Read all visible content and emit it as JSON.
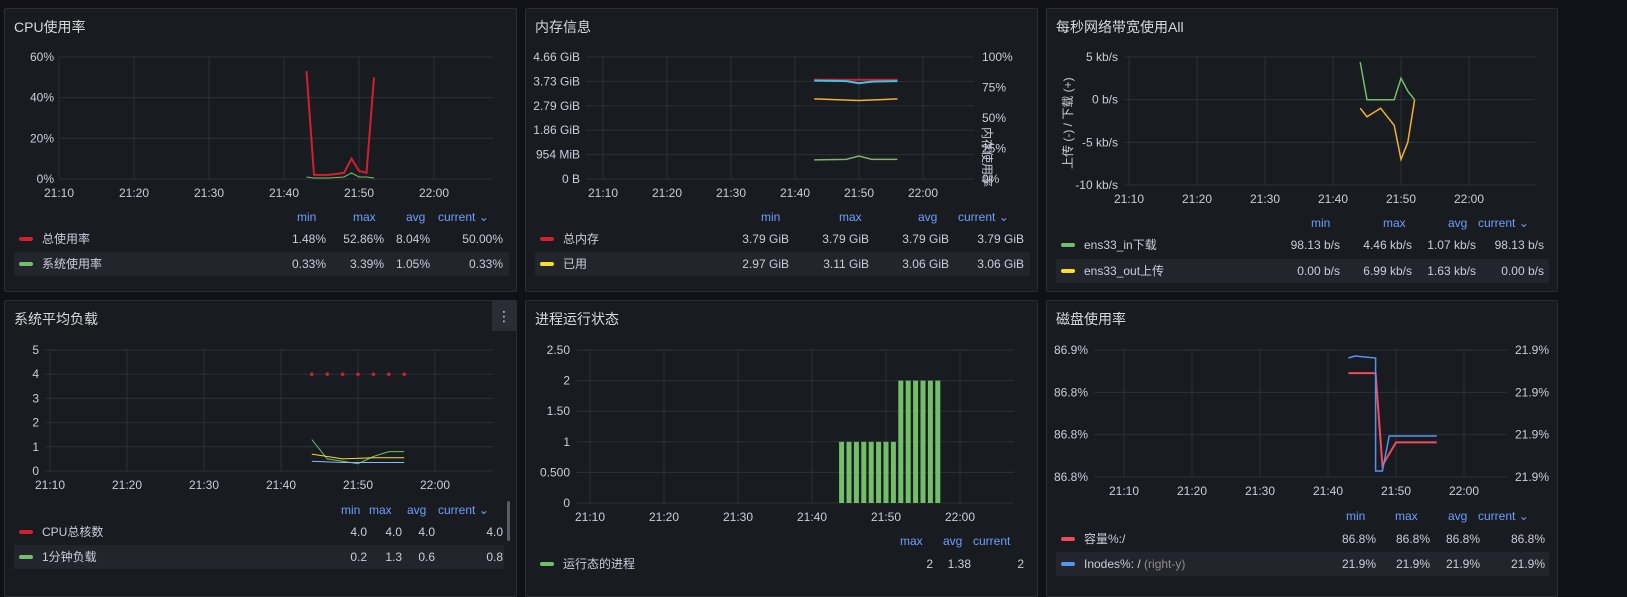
{
  "colors": {
    "red": "#d21f2e",
    "green": "#73bf69",
    "yellow": "#fade2a",
    "blue": "#5794f2",
    "cyan": "#37c8e8",
    "orange": "#f2b132",
    "legend_header": "#6e9fff"
  },
  "panels": {
    "cpu": {
      "title": "CPU使用率",
      "y_ticks": [
        "60%",
        "40%",
        "20%",
        "0%"
      ],
      "x_ticks": [
        "21:10",
        "21:20",
        "21:30",
        "21:40",
        "21:50",
        "22:00"
      ],
      "legend_headers": [
        "min",
        "max",
        "avg",
        "current"
      ],
      "legend": [
        {
          "name": "总使用率",
          "min": "1.48%",
          "max": "52.86%",
          "avg": "8.04%",
          "current": "50.00%",
          "color": "#d21f2e"
        },
        {
          "name": "系统使用率",
          "min": "0.33%",
          "max": "3.39%",
          "avg": "1.05%",
          "current": "0.33%",
          "color": "#73bf69"
        }
      ]
    },
    "mem": {
      "title": "内存信息",
      "y_ticks": [
        "4.66 GiB",
        "3.73 GiB",
        "2.79 GiB",
        "1.86 GiB",
        "954 MiB",
        "0 B"
      ],
      "y2_ticks": [
        "100%",
        "75%",
        "50%",
        "25%",
        "0%"
      ],
      "y2_label": "内存使用率",
      "x_ticks": [
        "21:10",
        "21:20",
        "21:30",
        "21:40",
        "21:50",
        "22:00"
      ],
      "legend_headers": [
        "min",
        "max",
        "avg",
        "current"
      ],
      "legend": [
        {
          "name": "总内存",
          "min": "3.79 GiB",
          "max": "3.79 GiB",
          "avg": "3.79 GiB",
          "current": "3.79 GiB",
          "color": "#d21f2e"
        },
        {
          "name": "已用",
          "min": "2.97 GiB",
          "max": "3.11 GiB",
          "avg": "3.06 GiB",
          "current": "3.06 GiB",
          "color": "#fade2a"
        }
      ]
    },
    "net": {
      "title": "每秒网络带宽使用All",
      "y_ticks": [
        "5 kb/s",
        "0 b/s",
        "-5 kb/s",
        "-10 kb/s"
      ],
      "y_label": "上传 (-) / 下载 (+)",
      "x_ticks": [
        "21:10",
        "21:20",
        "21:30",
        "21:40",
        "21:50",
        "22:00"
      ],
      "legend_headers": [
        "min",
        "max",
        "avg",
        "current"
      ],
      "legend": [
        {
          "name": "ens33_in下载",
          "min": "98.13 b/s",
          "max": "4.46 kb/s",
          "avg": "1.07 kb/s",
          "current": "98.13 b/s",
          "color": "#73bf69"
        },
        {
          "name": "ens33_out上传",
          "min": "0.00 b/s",
          "max": "6.99 kb/s",
          "avg": "1.63 kb/s",
          "current": "0.00 b/s",
          "color": "#fade2a"
        }
      ]
    },
    "load": {
      "title": "系统平均负载",
      "menu": "⋮",
      "y_ticks": [
        "5",
        "4",
        "3",
        "2",
        "1",
        "0"
      ],
      "x_ticks": [
        "21:10",
        "21:20",
        "21:30",
        "21:40",
        "21:50",
        "22:00"
      ],
      "legend_headers": [
        "min",
        "max",
        "avg",
        "current"
      ],
      "legend": [
        {
          "name": "CPU总核数",
          "min": "4.0",
          "max": "4.0",
          "avg": "4.0",
          "current": "4.0",
          "color": "#d21f2e"
        },
        {
          "name": "1分钟负载",
          "min": "0.2",
          "max": "1.3",
          "avg": "0.6",
          "current": "0.8",
          "color": "#73bf69"
        }
      ]
    },
    "proc": {
      "title": "进程运行状态",
      "y_ticks": [
        "2.50",
        "2",
        "1.50",
        "1",
        "0.500",
        "0"
      ],
      "x_ticks": [
        "21:10",
        "21:20",
        "21:30",
        "21:40",
        "21:50",
        "22:00"
      ],
      "legend_headers": [
        "max",
        "avg",
        "current"
      ],
      "legend": [
        {
          "name": "运行态的进程",
          "max": "2",
          "avg": "1.38",
          "current": "2",
          "color": "#73bf69"
        }
      ]
    },
    "disk": {
      "title": "磁盘使用率",
      "y_ticks": [
        "86.9%",
        "86.8%",
        "86.8%",
        "86.8%"
      ],
      "y2_ticks": [
        "21.9%",
        "21.9%",
        "21.9%",
        "21.9%"
      ],
      "x_ticks": [
        "21:10",
        "21:20",
        "21:30",
        "21:40",
        "21:50",
        "22:00"
      ],
      "legend_headers": [
        "min",
        "max",
        "avg",
        "current"
      ],
      "legend": [
        {
          "name": "容量%:/",
          "hint": "",
          "min": "86.8%",
          "max": "86.8%",
          "avg": "86.8%",
          "current": "86.8%",
          "color": "#f2495c"
        },
        {
          "name": "Inodes%: /",
          "hint": "(right-y)",
          "min": "21.9%",
          "max": "21.9%",
          "avg": "21.9%",
          "current": "21.9%",
          "color": "#5794f2"
        }
      ]
    }
  },
  "chart_data": [
    {
      "type": "line",
      "title": "CPU使用率",
      "ylim": [
        0,
        60
      ],
      "x": [
        "21:43",
        "21:44",
        "21:46",
        "21:48",
        "21:49",
        "21:50",
        "21:51",
        "21:52"
      ],
      "series": [
        {
          "name": "总使用率",
          "values": [
            53,
            2,
            2,
            3,
            10,
            4,
            3,
            50
          ]
        },
        {
          "name": "系统使用率",
          "values": [
            1,
            0.5,
            0.5,
            1,
            3,
            1,
            1,
            0.5
          ]
        }
      ]
    },
    {
      "type": "line",
      "title": "内存信息",
      "x": [
        "21:43",
        "21:50",
        "21:56"
      ],
      "series": [
        {
          "name": "总内存",
          "values": [
            3.79,
            3.79,
            3.79
          ]
        },
        {
          "name": "已用",
          "values": [
            3.06,
            3.0,
            3.06
          ]
        }
      ]
    },
    {
      "type": "line",
      "title": "每秒网络带宽使用All",
      "ylim": [
        -10,
        5
      ],
      "x": [
        "21:44",
        "21:45",
        "21:47",
        "21:49",
        "21:50",
        "21:51",
        "21:52"
      ],
      "series": [
        {
          "name": "ens33_in下载",
          "values": [
            4.4,
            0,
            0,
            0,
            2.5,
            1,
            0
          ]
        },
        {
          "name": "ens33_out上传",
          "values": [
            -1,
            -2,
            -1,
            -3,
            -7,
            -5,
            0
          ]
        }
      ]
    },
    {
      "type": "line",
      "title": "系统平均负载",
      "ylim": [
        0,
        5
      ],
      "x": [
        "21:44",
        "21:46",
        "21:48",
        "21:50",
        "21:52",
        "21:54",
        "21:56"
      ],
      "series": [
        {
          "name": "CPU总核数",
          "values": [
            4,
            4,
            4,
            4,
            4,
            4,
            4
          ]
        },
        {
          "name": "1分钟负载",
          "values": [
            1.3,
            0.5,
            0.4,
            0.3,
            0.6,
            0.8,
            0.8
          ]
        }
      ]
    },
    {
      "type": "bar",
      "title": "进程运行状态",
      "ylim": [
        0,
        2.5
      ],
      "categories": [
        "21:44",
        "21:45",
        "21:46",
        "21:47",
        "21:48",
        "21:49",
        "21:50",
        "21:51",
        "21:52",
        "21:53",
        "21:54",
        "21:55",
        "21:56",
        "21:57"
      ],
      "values": [
        1,
        1,
        1,
        1,
        1,
        1,
        1,
        1,
        2,
        2,
        2,
        2,
        2,
        2
      ]
    },
    {
      "type": "line",
      "title": "磁盘使用率",
      "x": [
        "21:43",
        "21:47",
        "21:48",
        "21:50",
        "21:56"
      ],
      "series": [
        {
          "name": "容量%:/",
          "values": [
            86.84,
            86.84,
            86.8,
            86.81,
            86.81
          ]
        },
        {
          "name": "Inodes%: /",
          "values": [
            21.9,
            21.9,
            21.9,
            21.9,
            21.9
          ]
        }
      ]
    }
  ]
}
